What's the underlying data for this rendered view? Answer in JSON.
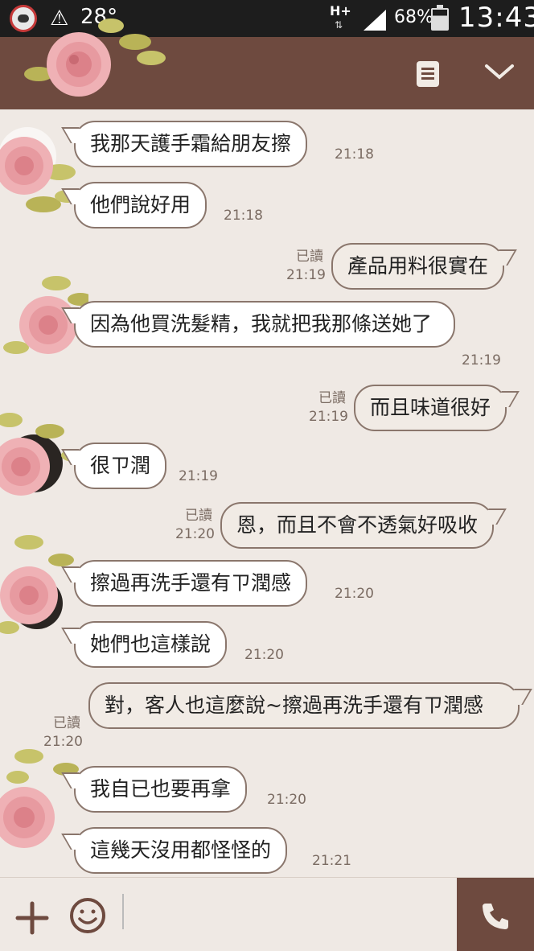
{
  "status_bar": {
    "temperature": "28°",
    "network": "H+",
    "network_arrows": "⇅",
    "battery": "68%",
    "time": "13:43"
  },
  "header": {
    "menu_icon": "list-icon",
    "collapse_icon": "chevron-down-icon"
  },
  "messages": [
    {
      "text": "我那天護手霜給朋友擦",
      "time": "21:18"
    },
    {
      "text": "他們說好用",
      "time": "21:18"
    },
    {
      "text": "產品用料很實在",
      "time": "21:19",
      "read": "已讀"
    },
    {
      "text": "因為他買洗髮精，我就把我那條送她了",
      "time": "21:19"
    },
    {
      "text": "而且味道很好",
      "time": "21:19",
      "read": "已讀"
    },
    {
      "text": "很ㄗ潤",
      "time": "21:19"
    },
    {
      "text": "恩，而且不會不透氣好吸收",
      "time": "21:20",
      "read": "已讀"
    },
    {
      "text": "擦過再洗手還有ㄗ潤感",
      "time": "21:20"
    },
    {
      "text": "她們也這樣說",
      "time": "21:20"
    },
    {
      "text": "對，客人也這麼說~擦過再洗手還有ㄗ潤感",
      "time": "21:20",
      "read": "已讀"
    },
    {
      "text": "我自已也要再拿",
      "time": "21:20"
    },
    {
      "text": "這幾天沒用都怪怪的",
      "time": "21:21"
    }
  ],
  "composer": {
    "placeholder": "",
    "plus_icon": "plus-icon",
    "emoji_icon": "smiley-icon",
    "call_icon": "phone-icon"
  }
}
